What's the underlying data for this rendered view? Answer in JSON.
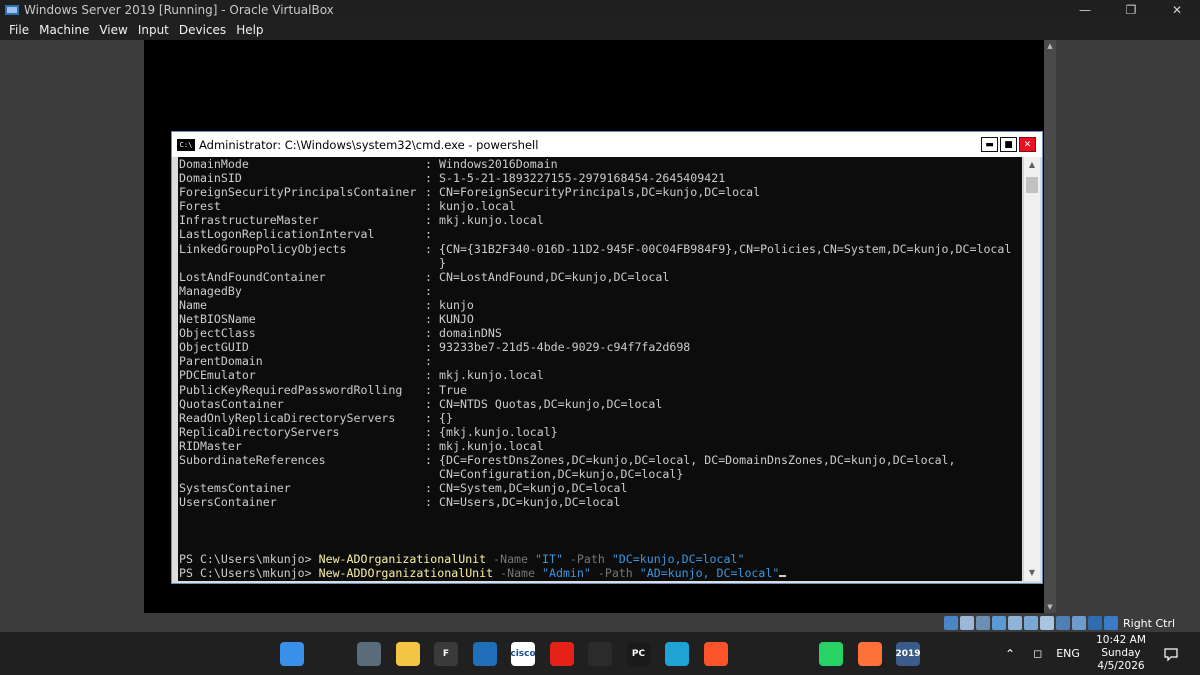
{
  "host": {
    "title": "Windows Server 2019 [Running] - Oracle VirtualBox",
    "menu": [
      "File",
      "Machine",
      "View",
      "Input",
      "Devices",
      "Help"
    ],
    "status_key_label": "Right Ctrl"
  },
  "cmd": {
    "title": "Administrator: C:\\Windows\\system32\\cmd.exe - powershell",
    "properties": [
      {
        "name": "DomainMode",
        "value": "Windows2016Domain"
      },
      {
        "name": "DomainSID",
        "value": "S-1-5-21-1893227155-2979168454-2645409421"
      },
      {
        "name": "ForeignSecurityPrincipalsContainer",
        "value": "CN=ForeignSecurityPrincipals,DC=kunjo,DC=local"
      },
      {
        "name": "Forest",
        "value": "kunjo.local"
      },
      {
        "name": "InfrastructureMaster",
        "value": "mkj.kunjo.local"
      },
      {
        "name": "LastLogonReplicationInterval",
        "value": ""
      },
      {
        "name": "LinkedGroupPolicyObjects",
        "value": "{CN={31B2F340-016D-11D2-945F-00C04FB984F9},CN=Policies,CN=System,DC=kunjo,DC=local"
      },
      {
        "name": "",
        "sep": "",
        "value": "}"
      },
      {
        "name": "LostAndFoundContainer",
        "value": "CN=LostAndFound,DC=kunjo,DC=local"
      },
      {
        "name": "ManagedBy",
        "value": ""
      },
      {
        "name": "Name",
        "value": "kunjo"
      },
      {
        "name": "NetBIOSName",
        "value": "KUNJO"
      },
      {
        "name": "ObjectClass",
        "value": "domainDNS"
      },
      {
        "name": "ObjectGUID",
        "value": "93233be7-21d5-4bde-9029-c94f7fa2d698"
      },
      {
        "name": "ParentDomain",
        "value": ""
      },
      {
        "name": "PDCEmulator",
        "value": "mkj.kunjo.local"
      },
      {
        "name": "PublicKeyRequiredPasswordRolling",
        "value": "True"
      },
      {
        "name": "QuotasContainer",
        "value": "CN=NTDS Quotas,DC=kunjo,DC=local"
      },
      {
        "name": "ReadOnlyReplicaDirectoryServers",
        "value": "{}"
      },
      {
        "name": "ReplicaDirectoryServers",
        "value": "{mkj.kunjo.local}"
      },
      {
        "name": "RIDMaster",
        "value": "mkj.kunjo.local"
      },
      {
        "name": "SubordinateReferences",
        "value": "{DC=ForestDnsZones,DC=kunjo,DC=local, DC=DomainDnsZones,DC=kunjo,DC=local,"
      },
      {
        "name": "",
        "sep": "",
        "value": "CN=Configuration,DC=kunjo,DC=local}"
      },
      {
        "name": "SystemsContainer",
        "value": "CN=System,DC=kunjo,DC=local"
      },
      {
        "name": "UsersContainer",
        "value": "CN=Users,DC=kunjo,DC=local"
      }
    ],
    "separator": ": ",
    "commands": [
      {
        "prompt": "PS C:\\Users\\mkunjo> ",
        "cmdlet": "New-ADOrganizationalUnit",
        "p1": " -Name ",
        "v1": "\"IT\"",
        "p2": " -Path ",
        "v2": "\"DC=kunjo,DC=local\""
      },
      {
        "prompt": "PS C:\\Users\\mkunjo> ",
        "cmdlet": "New-ADDOrganizationalUnit",
        "p1": " -Name ",
        "v1": "\"Admin\"",
        "p2": " -Path ",
        "v2": "\"AD=kunjo, DC=local\""
      }
    ]
  },
  "taskbar": {
    "icons": [
      {
        "name": "start-icon",
        "label": "",
        "color": "#3a8fe8"
      },
      {
        "name": "search-icon",
        "label": "",
        "color": "#202020"
      },
      {
        "name": "task-view-icon",
        "label": "",
        "color": "#5a6b7a"
      },
      {
        "name": "file-explorer-icon",
        "label": "",
        "color": "#f4c542"
      },
      {
        "name": "app-f-icon",
        "label": "F",
        "color": "#3a3a3a"
      },
      {
        "name": "virtualbox-icon",
        "label": "",
        "color": "#1e6fb8"
      },
      {
        "name": "cisco-icon",
        "label": "cisco",
        "color": "#ffffff"
      },
      {
        "name": "youtube-icon",
        "label": "",
        "color": "#e62117"
      },
      {
        "name": "obs-icon",
        "label": "",
        "color": "#2b2b2b"
      },
      {
        "name": "pycharm-icon",
        "label": "PC",
        "color": "#1a1a1a"
      },
      {
        "name": "edge-icon",
        "label": "",
        "color": "#1fa3d6"
      },
      {
        "name": "brave-icon",
        "label": "",
        "color": "#fb542b"
      },
      {
        "name": "chatgpt-icon",
        "label": "",
        "color": "#202020"
      },
      {
        "name": "github-icon",
        "label": "",
        "color": "#202020"
      },
      {
        "name": "whatsapp-icon",
        "label": "",
        "color": "#25d366"
      },
      {
        "name": "firefox-icon",
        "label": "",
        "color": "#ff7139"
      },
      {
        "name": "vbox-vm-icon",
        "label": "2019",
        "color": "#3b5b8a"
      }
    ],
    "lang": "ENG",
    "time": "10:42 AM",
    "day": "Sunday",
    "date": "4/5/2026"
  }
}
